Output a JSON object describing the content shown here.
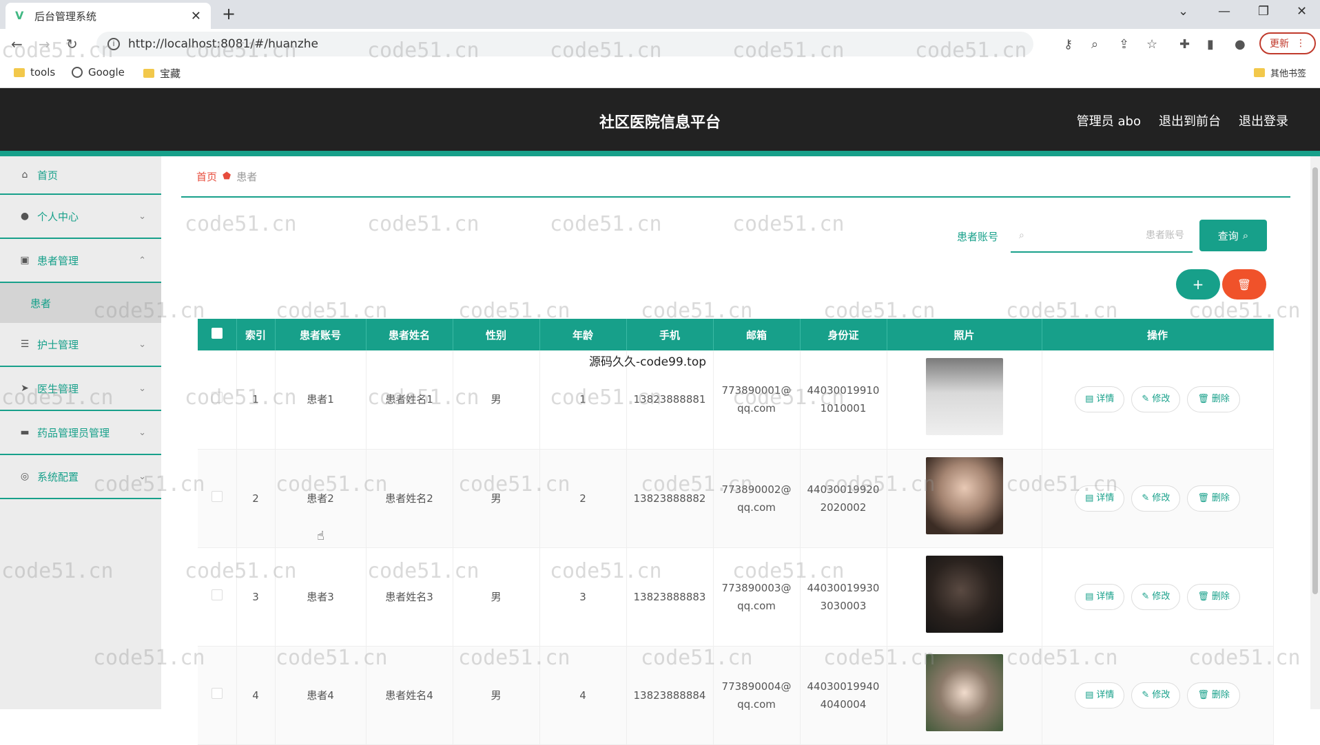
{
  "browser": {
    "tab_title": "后台管理系统",
    "url": "http://localhost:8081/#/huanzhe",
    "update_label": "更新",
    "bookmarks": [
      "tools",
      "Google",
      "宝藏"
    ],
    "other_bookmarks": "其他书签"
  },
  "header": {
    "title": "社区医院信息平台",
    "user": "管理员 abo",
    "to_front": "退出到前台",
    "logout": "退出登录"
  },
  "sidebar": {
    "items": [
      {
        "label": "首页",
        "icon": "home-icon"
      },
      {
        "label": "个人中心",
        "icon": "user-icon"
      },
      {
        "label": "患者管理",
        "icon": "clipboard-icon"
      },
      {
        "label": "护士管理",
        "icon": "sliders-icon"
      },
      {
        "label": "医生管理",
        "icon": "send-icon"
      },
      {
        "label": "药品管理员管理",
        "icon": "monitor-icon"
      },
      {
        "label": "系统配置",
        "icon": "settings-icon"
      }
    ],
    "sub_active": "患者"
  },
  "breadcrumb": {
    "home": "首页",
    "current": "患者"
  },
  "search": {
    "label": "患者账号",
    "placeholder": "患者账号",
    "button": "查询"
  },
  "table": {
    "headers": [
      "索引",
      "患者账号",
      "患者姓名",
      "性别",
      "年龄",
      "手机",
      "邮箱",
      "身份证",
      "照片",
      "操作"
    ],
    "rows": [
      {
        "index": "1",
        "account": "患者1",
        "name": "患者姓名1",
        "gender": "男",
        "age": "1",
        "phone": "13823888881",
        "email1": "773890001@",
        "email2": "qq.com",
        "id1": "44030019910",
        "id2": "1010001"
      },
      {
        "index": "2",
        "account": "患者2",
        "name": "患者姓名2",
        "gender": "男",
        "age": "2",
        "phone": "13823888882",
        "email1": "773890002@",
        "email2": "qq.com",
        "id1": "44030019920",
        "id2": "2020002"
      },
      {
        "index": "3",
        "account": "患者3",
        "name": "患者姓名3",
        "gender": "男",
        "age": "3",
        "phone": "13823888883",
        "email1": "773890003@",
        "email2": "qq.com",
        "id1": "44030019930",
        "id2": "3030003"
      },
      {
        "index": "4",
        "account": "患者4",
        "name": "患者姓名4",
        "gender": "男",
        "age": "4",
        "phone": "13823888884",
        "email1": "773890004@",
        "email2": "qq.com",
        "id1": "44030019940",
        "id2": "4040004"
      }
    ],
    "ops": {
      "detail": "详情",
      "edit": "修改",
      "delete": "删除"
    }
  },
  "notice": "源码久久-code99.top",
  "watermark": "code51.cn",
  "colors": {
    "accent": "#17a08a",
    "danger": "#f0522a",
    "header_bg": "#222222"
  }
}
